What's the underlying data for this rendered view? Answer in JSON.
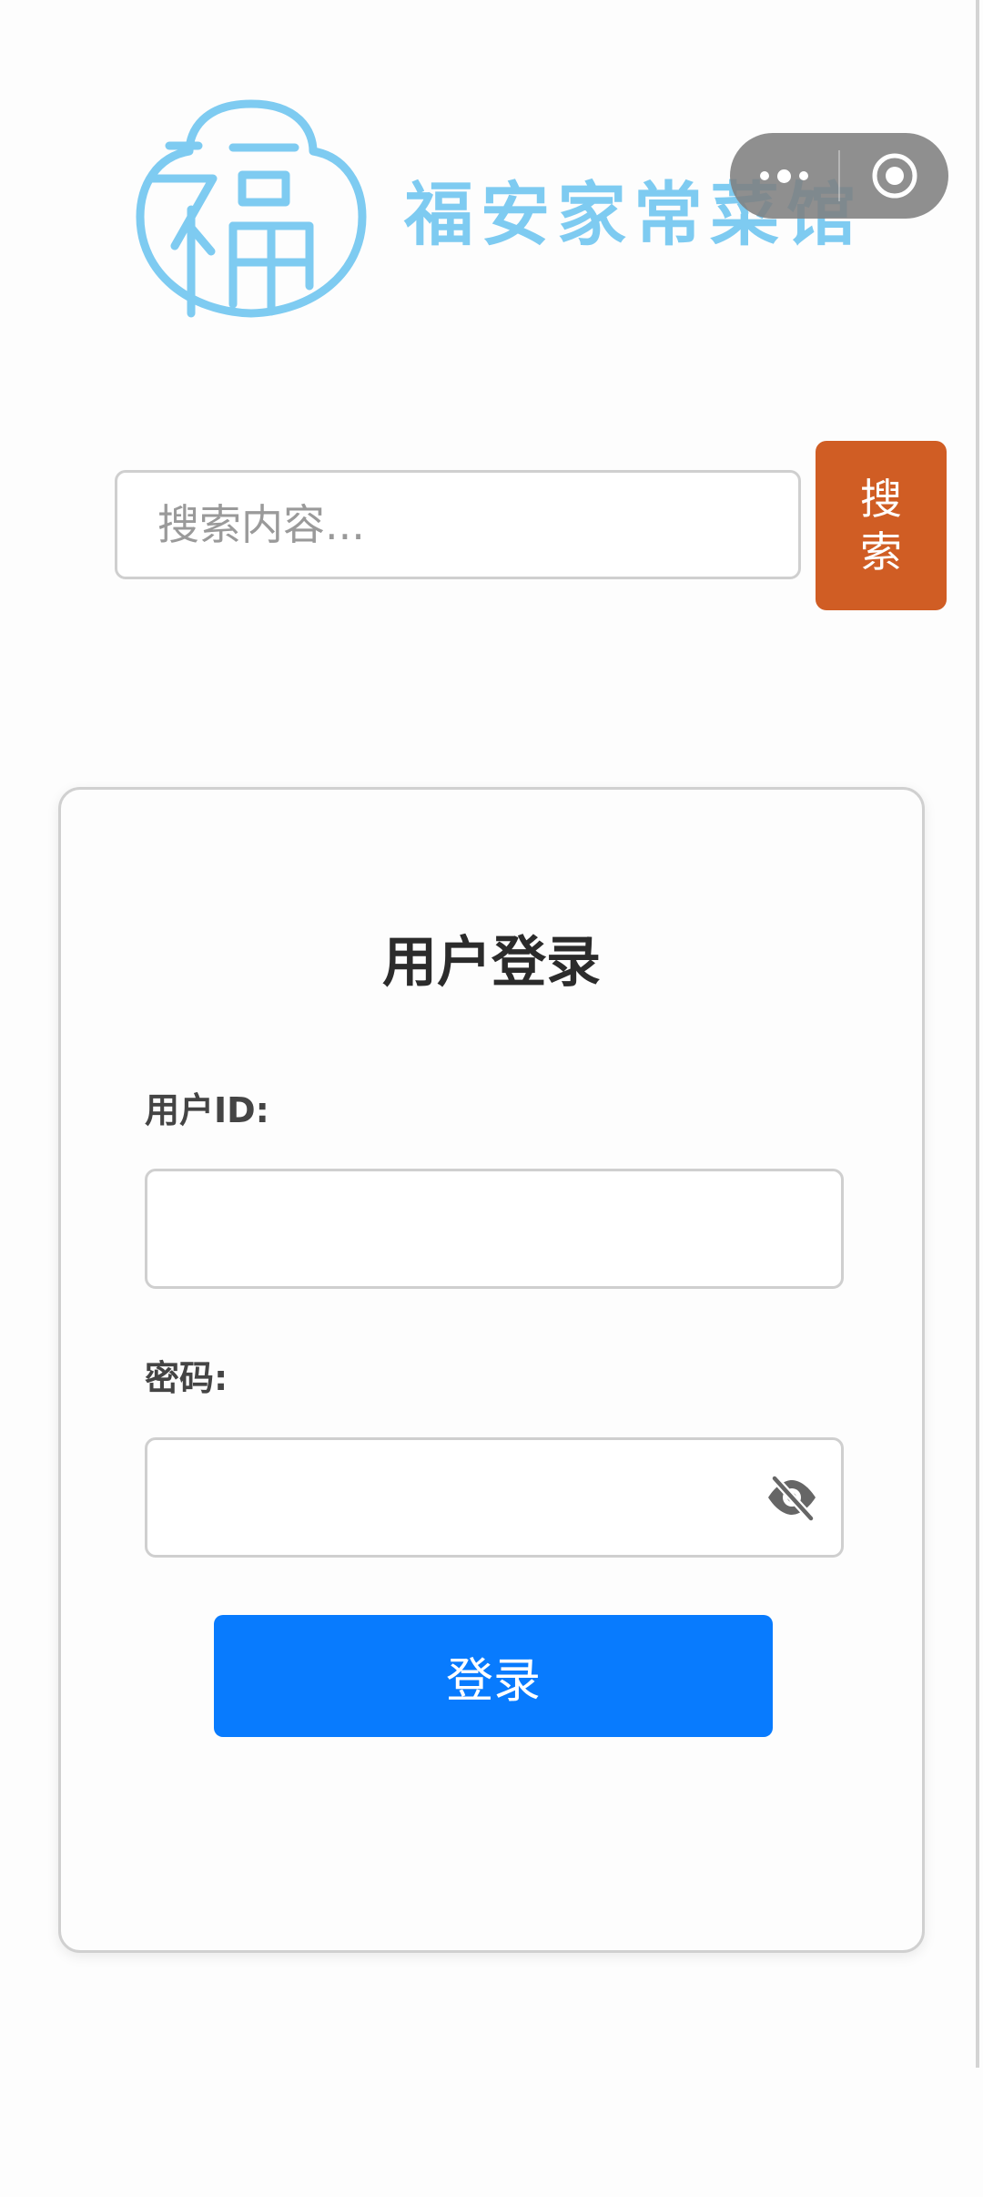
{
  "brand": {
    "logo_char": "福",
    "name": "福安家常菜馆",
    "color": "#7ecbf1"
  },
  "capsule": {
    "more_icon": "more-dots-icon",
    "close_icon": "target-circle-icon"
  },
  "search": {
    "placeholder": "搜索内容...",
    "value": "",
    "button_label": "搜索",
    "button_color": "#d05d24"
  },
  "login": {
    "title": "用户登录",
    "userid_label": "用户ID:",
    "userid_value": "",
    "password_label": "密码:",
    "password_value": "",
    "password_toggle_icon": "eye-slash-icon",
    "submit_label": "登录",
    "submit_color": "#087bfe"
  }
}
